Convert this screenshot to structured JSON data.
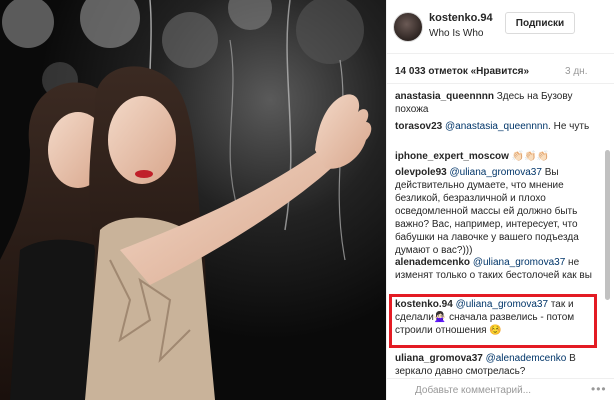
{
  "header": {
    "username": "kostenko.94",
    "location": "Who Is Who",
    "follow_label": "Подписки"
  },
  "stats": {
    "likes": "14 033 отметок «Нравится»",
    "date": "3 дн."
  },
  "comments": [
    {
      "user": "anastasia_queennnn",
      "mention": "",
      "text": "Здесь на Бузову похожа"
    },
    {
      "user": "torasov23",
      "mention": "@anastasia_queennnn",
      "text": ". Не чуть"
    },
    {
      "user": "iphone_expert_moscow",
      "mention": "",
      "text": "👏🏻👏🏻👏🏻"
    },
    {
      "user": "olevpole93",
      "mention": "@uliana_gromova37",
      "text": "Вы действительно думаете, что мнение безликой, безразличной и плохо осведомленной массы ей должно быть важно? Вас, например, интересует, что бабушки на лавочке у вашего подъезда думают о вас?)))"
    },
    {
      "user": "alenademcenko",
      "mention": "@uliana_gromova37",
      "text": "не изменят только о таких бестолочей как вы"
    },
    {
      "user": "kostenko.94",
      "mention": "@uliana_gromova37",
      "text": "так и сделали🙅🏻‍♀️ сначала развелись - потом строили отношения ☺️"
    },
    {
      "user": "uliana_gromova37",
      "mention": "@alenademcenko",
      "text": "В зеркало давно смотрелась?"
    }
  ],
  "add_comment": {
    "placeholder": "Добавьте комментарий...",
    "more_label": "•••"
  },
  "colors": {
    "highlight": "#e31b23",
    "mention": "#003569"
  }
}
